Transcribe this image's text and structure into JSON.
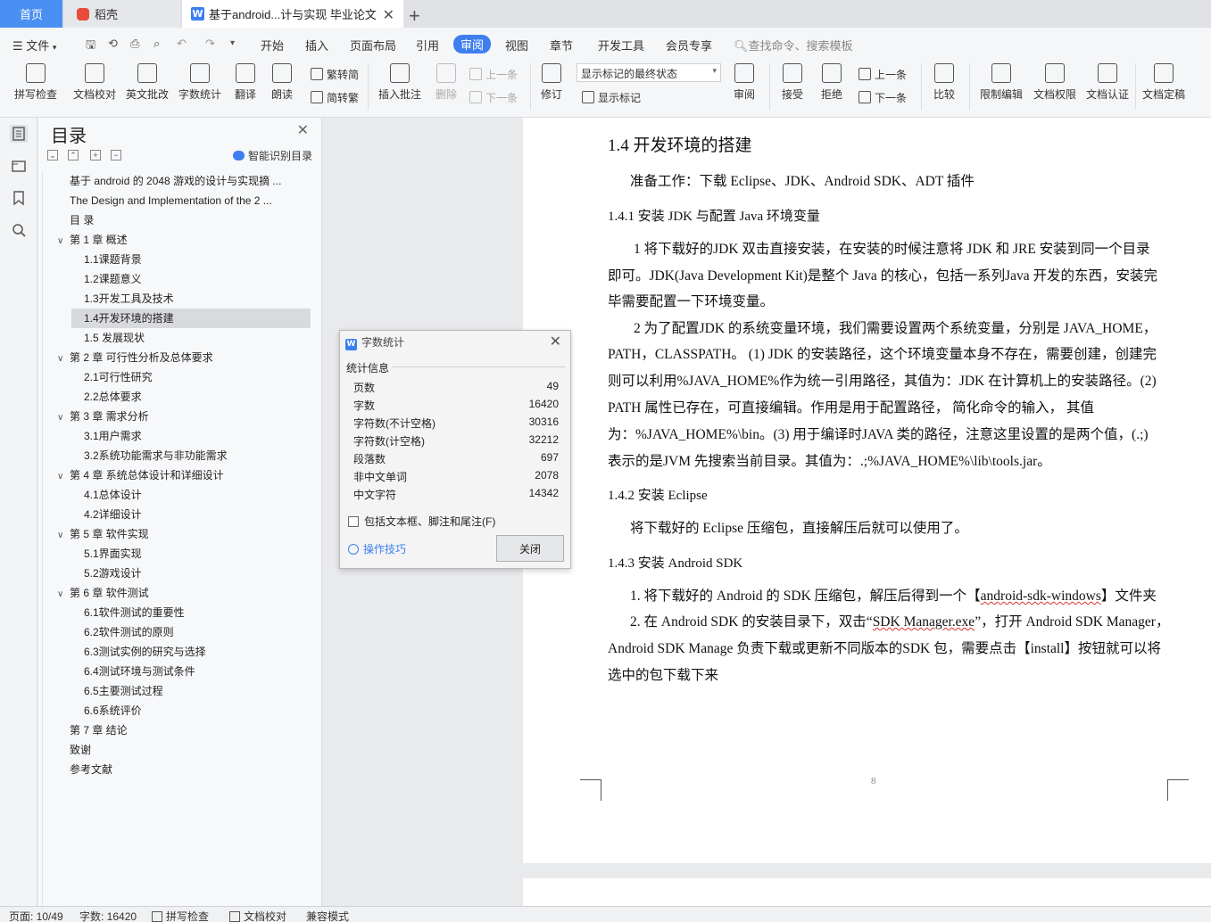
{
  "tabs": {
    "home": "首页",
    "daoke": "稻壳",
    "doc": "基于android...计与实现 毕业论文",
    "add": "+"
  },
  "menu": {
    "file": "文件",
    "items": [
      "开始",
      "插入",
      "页面布局",
      "引用",
      "审阅",
      "视图",
      "章节",
      "开发工具",
      "会员专享"
    ],
    "search": "查找命令、搜索模板"
  },
  "ribbon": {
    "spell": "拼写检查",
    "proof": "文档校对",
    "english": "英文批改",
    "wordcount": "字数统计",
    "translate": "翻译",
    "read": "朗读",
    "trad": "繁转简",
    "simp": "简转繁",
    "insert_comment": "插入批注",
    "delete": "删除",
    "prev": "上一条",
    "next": "下一条",
    "revise": "修订",
    "markup_state": "显示标记的最终状态",
    "show_markup": "显示标记",
    "review": "审阅",
    "accept": "接受",
    "reject": "拒绝",
    "prev2": "上一条",
    "next2": "下一条",
    "compare": "比较",
    "restrict": "限制编辑",
    "perm": "文档权限",
    "cert": "文档认证",
    "final": "文档定稿"
  },
  "toc": {
    "title": "目录",
    "smart": "智能识别目录",
    "items": [
      {
        "text": "基于 android 的 2048 游戏的设计与实现摘 ...",
        "level": 0,
        "caret": ""
      },
      {
        "text": "The Design and Implementation of the 2 ...",
        "level": 0,
        "caret": ""
      },
      {
        "text": "目 录",
        "level": 0,
        "caret": ""
      },
      {
        "text": "第 1 章 概述",
        "level": 0,
        "caret": "v"
      },
      {
        "text": "1.1课题背景",
        "level": 1,
        "caret": ""
      },
      {
        "text": "1.2课题意义",
        "level": 1,
        "caret": ""
      },
      {
        "text": "1.3开发工具及技术",
        "level": 1,
        "caret": ""
      },
      {
        "text": "1.4开发环境的搭建",
        "level": 1,
        "caret": "",
        "selected": true
      },
      {
        "text": "1.5 发展现状",
        "level": 1,
        "caret": ""
      },
      {
        "text": "第 2 章 可行性分析及总体要求",
        "level": 0,
        "caret": "v"
      },
      {
        "text": "2.1可行性研究",
        "level": 1,
        "caret": ""
      },
      {
        "text": "2.2总体要求",
        "level": 1,
        "caret": ""
      },
      {
        "text": "第 3 章 需求分析",
        "level": 0,
        "caret": "v"
      },
      {
        "text": "3.1用户需求",
        "level": 1,
        "caret": ""
      },
      {
        "text": "3.2系统功能需求与非功能需求",
        "level": 1,
        "caret": ""
      },
      {
        "text": "第 4 章 系统总体设计和详细设计",
        "level": 0,
        "caret": "v"
      },
      {
        "text": "4.1总体设计",
        "level": 1,
        "caret": ""
      },
      {
        "text": "4.2详细设计",
        "level": 1,
        "caret": ""
      },
      {
        "text": "第 5 章 软件实现",
        "level": 0,
        "caret": "v"
      },
      {
        "text": "5.1界面实现",
        "level": 1,
        "caret": ""
      },
      {
        "text": "5.2游戏设计",
        "level": 1,
        "caret": ""
      },
      {
        "text": "第 6 章 软件测试",
        "level": 0,
        "caret": "v"
      },
      {
        "text": "6.1软件测试的重要性",
        "level": 1,
        "caret": ""
      },
      {
        "text": "6.2软件测试的原则",
        "level": 1,
        "caret": ""
      },
      {
        "text": "6.3测试实例的研究与选择",
        "level": 1,
        "caret": ""
      },
      {
        "text": "6.4测试环境与测试条件",
        "level": 1,
        "caret": ""
      },
      {
        "text": "6.5主要测试过程",
        "level": 1,
        "caret": ""
      },
      {
        "text": "6.6系统评价",
        "level": 1,
        "caret": ""
      },
      {
        "text": "第 7 章 结论",
        "level": 0,
        "caret": ""
      },
      {
        "text": "致谢",
        "level": 0,
        "caret": ""
      },
      {
        "text": "参考文献",
        "level": 0,
        "caret": ""
      }
    ]
  },
  "doc": {
    "h_14": "1.4 开发环境的搭建",
    "prep": "准备工作：下载  Eclipse、JDK、Android SDK、ADT 插件",
    "h_141": "1.4.1 安装 JDK 与配置 Java 环境变量",
    "p1_l1": "1   将下载好的JDK 双击直接安装，在安装的时候注意将  JDK 和 JRE 安装到同一个目录",
    "p1_l2": "即可。JDK(Java Development Kit)是整个 Java 的核心，包括一系列Java 开发的东西，安装完",
    "p1_l3": "毕需要配置一下环境变量。",
    "p2_l1": "2   为了配置JDK 的系统变量环境，我们需要设置两个系统变量，分别是  JAVA_HOME，",
    "p2_l2": "PATH，CLASSPATH。 (1) JDK 的安装路径，这个环境变量本身不存在，需要创建，创建完",
    "p2_l3": "则可以利用%JAVA_HOME%作为统一引用路径，其值为：JDK 在计算机上的安装路径。(2)",
    "p2_l4": "PATH 属性已存在，可直接编辑。作用是用于配置路径，   简化命令的输入，   其值",
    "p2_l5": "为：%JAVA_HOME%\\bin。(3) 用于编译时JAVA 类的路径，注意这里设置的是两个值，(.;)",
    "p2_l6": "表示的是JVM 先搜索当前目录。其值为：.;%JAVA_HOME%\\lib\\tools.jar。",
    "h_142": "1.4.2  安装  Eclipse",
    "p3": "将下载好的   Eclipse 压缩包，直接解压后就可以使用了。",
    "h_143": "1.4.3 安装 Android SDK",
    "p4_l1a": "1.   将下载好的  Android 的 SDK 压缩包，解压后得到一个【",
    "p4_l1b": "android-sdk-windows",
    "p4_l1c": "】文件夹",
    "p4_l2a": "2. 在 Android SDK 的安装目录下，双击“",
    "p4_l2b": "SDK Manager.exe",
    "p4_l2c": "”，打开  Android SDK Manager，",
    "p4_l3": "Android SDK Manage 负责下载或更新不同版本的SDK 包，需要点击【install】按钮就可以将",
    "p4_l4": "选中的包下载下来",
    "page_num": "8"
  },
  "dialog": {
    "title": "字数统计",
    "section": "统计信息",
    "stats": [
      {
        "label": "页数",
        "value": "49"
      },
      {
        "label": "字数",
        "value": "16420"
      },
      {
        "label": "字符数(不计空格)",
        "value": "30316"
      },
      {
        "label": "字符数(计空格)",
        "value": "32212"
      },
      {
        "label": "段落数",
        "value": "697"
      },
      {
        "label": "非中文单词",
        "value": "2078"
      },
      {
        "label": "中文字符",
        "value": "14342"
      }
    ],
    "include": "包括文本框、脚注和尾注(F)",
    "tips": "操作技巧",
    "close": "关闭"
  },
  "status": {
    "page": "页面: 10/49",
    "words": "字数: 16420",
    "spell": "拼写检查",
    "proof": "文档校对",
    "compat": "兼容模式"
  },
  "colors": {
    "accent": "#3d7fee",
    "home_tab": "#4a8ff2"
  }
}
